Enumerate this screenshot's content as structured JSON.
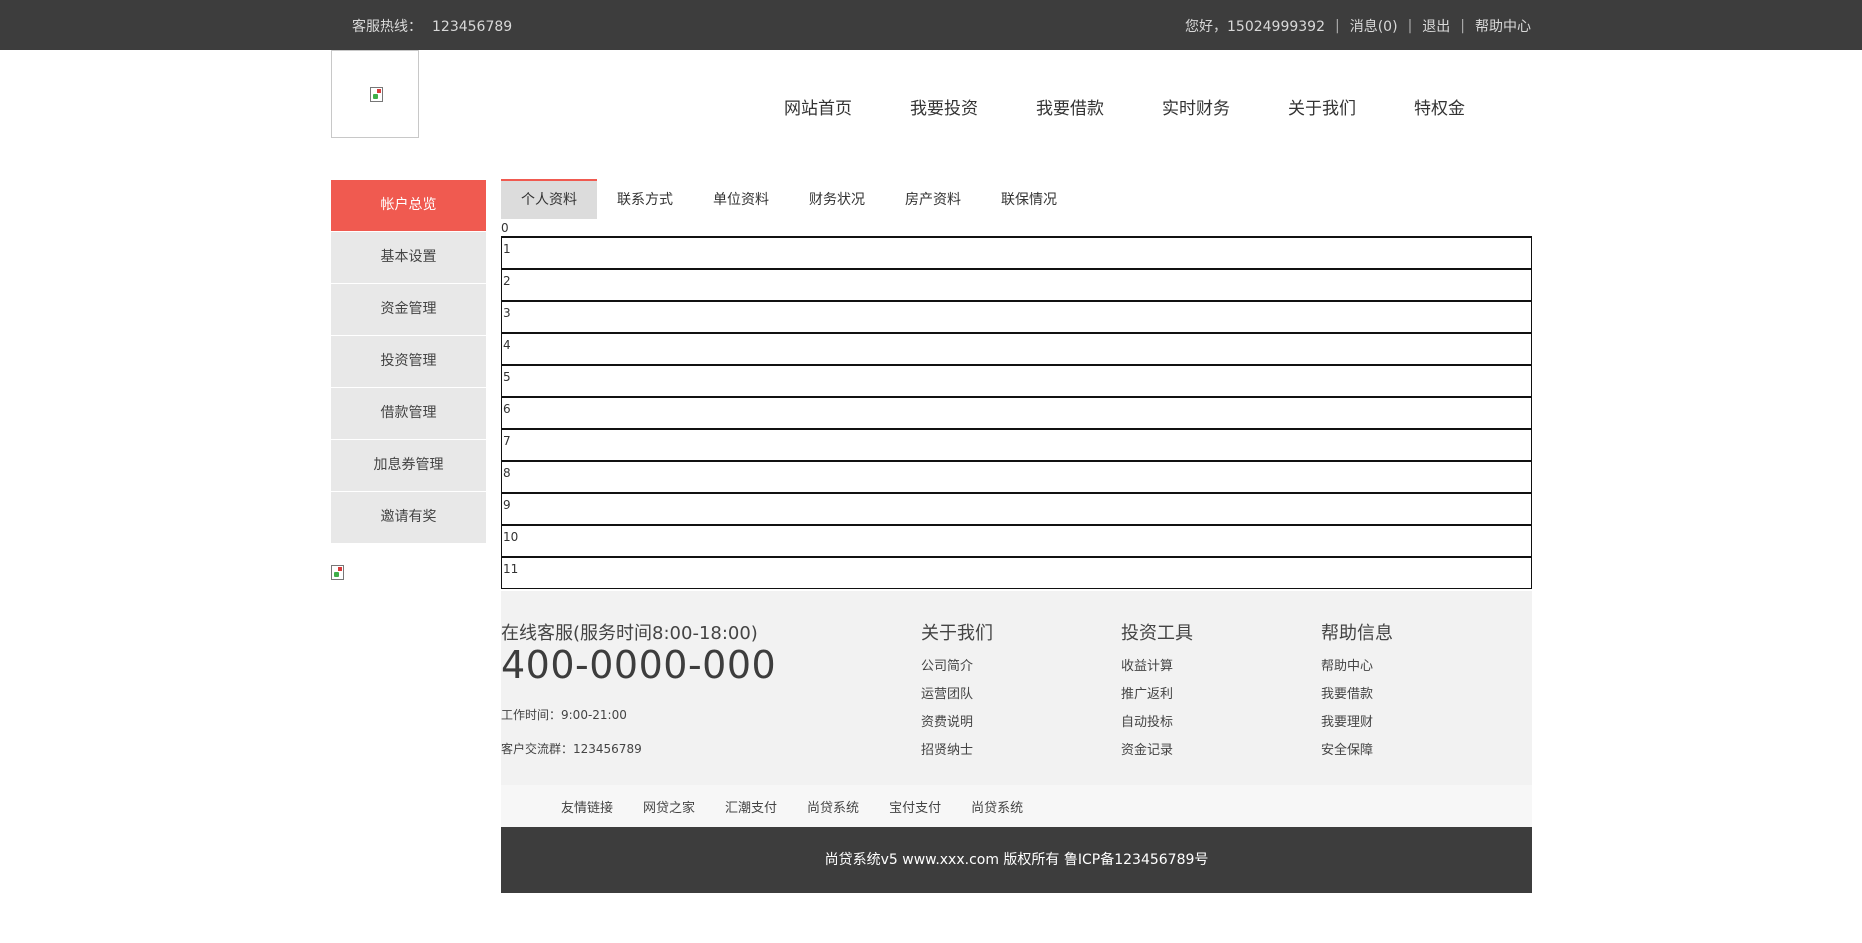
{
  "topbar": {
    "hotline_label": "客服热线：",
    "hotline_number": "123456789",
    "greeting": "您好，15024999392",
    "messages": "消息(0)",
    "logout": "退出",
    "help": "帮助中心",
    "separator": "|"
  },
  "nav": [
    "网站首页",
    "我要投资",
    "我要借款",
    "实时财务",
    "关于我们",
    "特权金"
  ],
  "sidebar": {
    "items": [
      {
        "label": "帐户总览"
      },
      {
        "label": "基本设置"
      },
      {
        "label": "资金管理"
      },
      {
        "label": "投资管理"
      },
      {
        "label": "借款管理"
      },
      {
        "label": "加息券管理"
      },
      {
        "label": "邀请有奖"
      }
    ]
  },
  "tabs": [
    "个人资料",
    "联系方式",
    "单位资料",
    "财务状况",
    "房产资料",
    "联保情况"
  ],
  "rows": [
    "0",
    "1",
    "2",
    "3",
    "4",
    "5",
    "6",
    "7",
    "8",
    "9",
    "10",
    "11"
  ],
  "footer": {
    "service_title": "在线客服(服务时间8:00-18:00)",
    "service_phone": "400-0000-000",
    "work_hours": "工作时间：9:00-21:00",
    "customer_group": "客户交流群：123456789",
    "columns": [
      {
        "title": "关于我们",
        "links": [
          "公司简介",
          "运营团队",
          "资费说明",
          "招贤纳士"
        ]
      },
      {
        "title": "投资工具",
        "links": [
          "收益计算",
          "推广返利",
          "自动投标",
          "资金记录"
        ]
      },
      {
        "title": "帮助信息",
        "links": [
          "帮助中心",
          "我要借款",
          "我要理财",
          "安全保障"
        ]
      }
    ],
    "friend_links_label": "友情链接",
    "friend_links": [
      "网贷之家",
      "汇潮支付",
      "尚贷系统",
      "宝付支付",
      "尚贷系统"
    ],
    "copyright": "尚贷系统v5 www.xxx.com 版权所有 鲁ICP备123456789号"
  },
  "colors": {
    "topbar_bg": "#3d3d3d",
    "accent": "#f05a50",
    "sidebar_bg": "#e8e8e8",
    "footer_bg": "#f2f2f2"
  },
  "icons": {
    "logo": "broken-image-icon",
    "sidebar_image": "broken-image-icon"
  }
}
